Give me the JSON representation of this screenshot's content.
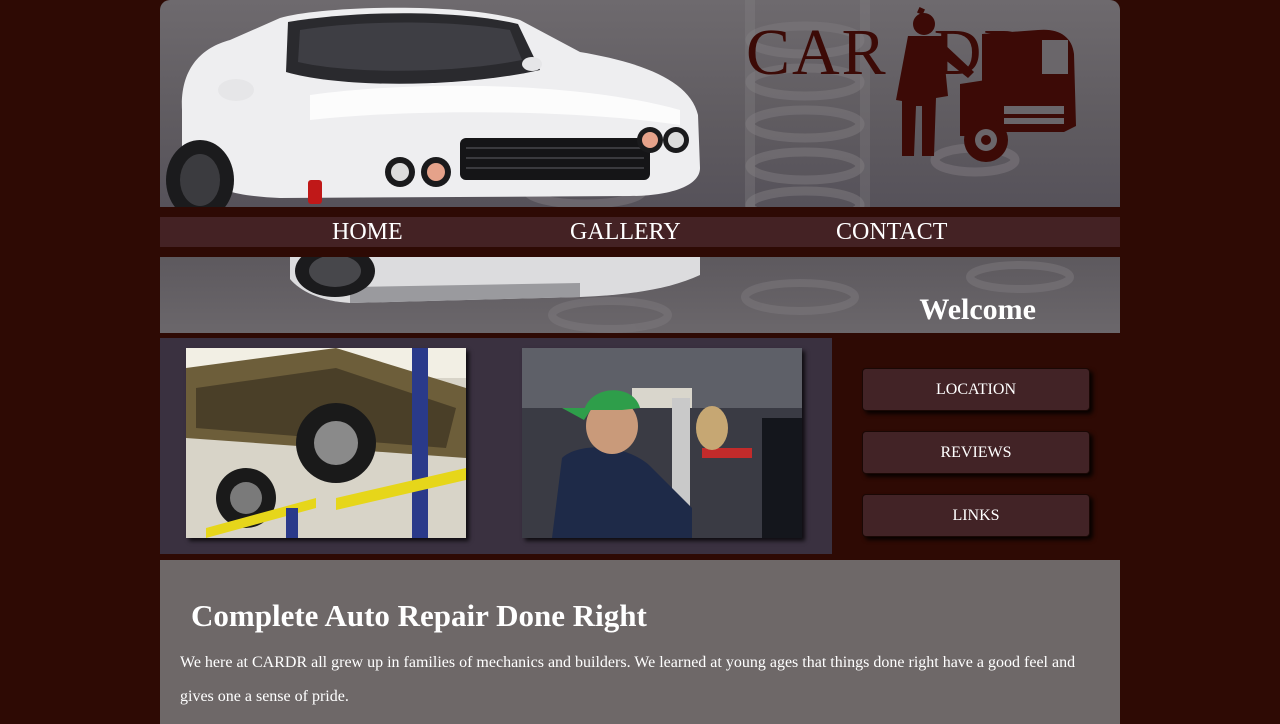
{
  "header": {
    "logo": {
      "text": "CAR DR",
      "part1": "CAR",
      "part2": "DR"
    }
  },
  "nav": {
    "items": [
      {
        "label": "HOME"
      },
      {
        "label": "GALLERY"
      },
      {
        "label": "CONTACT"
      }
    ]
  },
  "welcome": {
    "title": "Welcome"
  },
  "gallery": {
    "photos": [
      {
        "subject": "car on lift, underside view"
      },
      {
        "subject": "mechanic working under vehicle"
      }
    ]
  },
  "sidebar": {
    "buttons": [
      {
        "label": "LOCATION"
      },
      {
        "label": "REVIEWS"
      },
      {
        "label": "LINKS"
      }
    ]
  },
  "main": {
    "title": "Complete Auto Repair Done Right",
    "body": "We here at CARDR all grew up in families of mechanics and builders. We learned at young ages that things done right have a good feel and gives one a sense of pride."
  },
  "colors": {
    "page_background": "#2e0a04",
    "nav_band": "#442224",
    "button": "#422326",
    "photo_panel": "#3a3140",
    "content_panel": "#6e6868",
    "logo": "#3c0a06"
  }
}
